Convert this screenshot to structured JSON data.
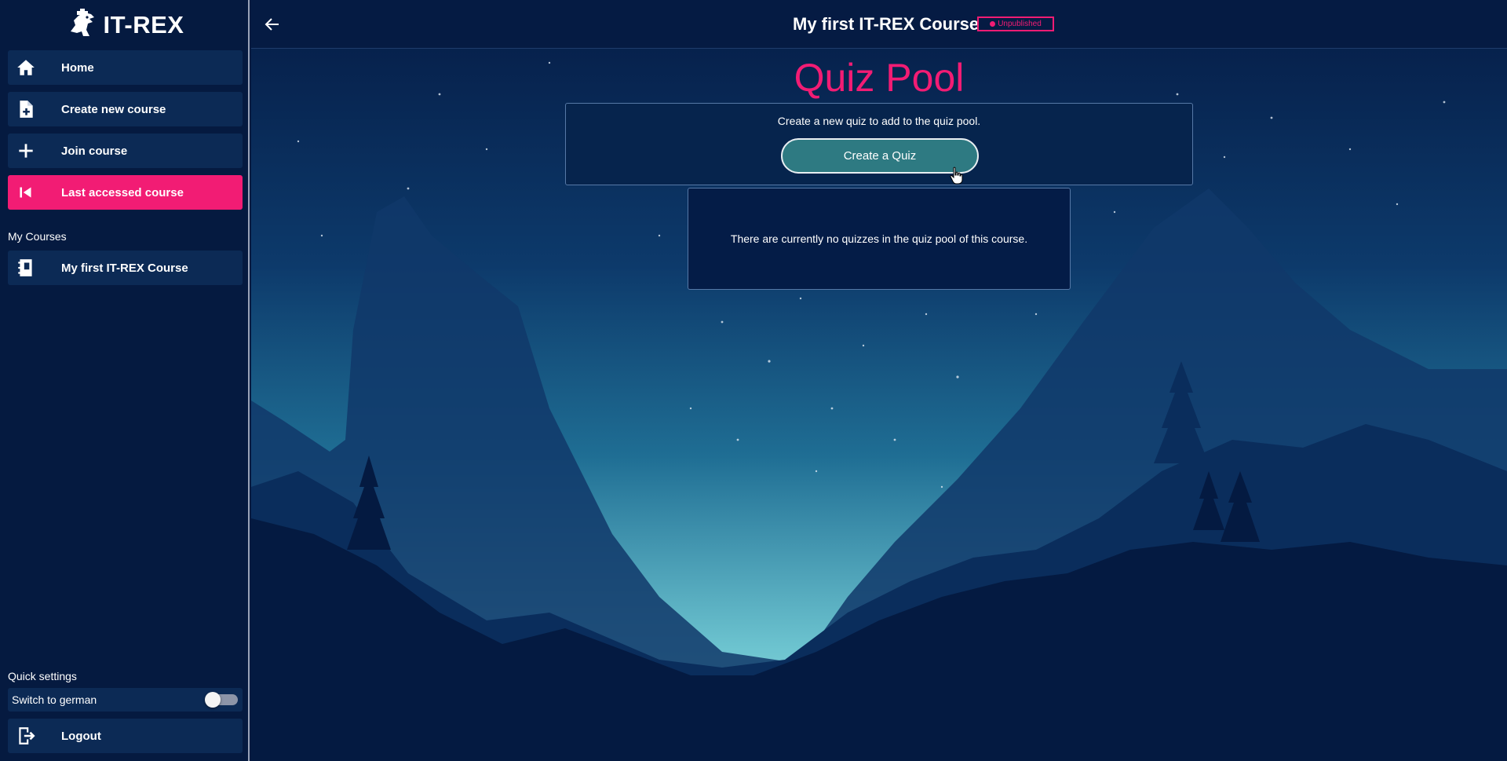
{
  "brand": {
    "name": "IT-REX",
    "logo_icon": "dinosaur-logo-icon"
  },
  "sidebar": {
    "items": [
      {
        "label": "Home",
        "icon": "home-icon"
      },
      {
        "label": "Create new course",
        "icon": "file-plus-icon"
      },
      {
        "label": "Join course",
        "icon": "plus-icon"
      },
      {
        "label": "Last accessed course",
        "icon": "skip-back-icon",
        "active": true
      }
    ],
    "my_courses_label": "My Courses",
    "courses": [
      {
        "label": "My first IT-REX Course",
        "icon": "notebook-icon"
      }
    ],
    "quick_settings_label": "Quick settings",
    "language_toggle": {
      "label": "Switch to german",
      "on": false
    },
    "logout_label": "Logout"
  },
  "header": {
    "course_title": "My first IT-REX Course",
    "status_badge": "Unpublished"
  },
  "main": {
    "page_title": "Quiz Pool",
    "create_prompt": "Create a new quiz to add to the quiz pool.",
    "create_button_label": "Create a Quiz",
    "empty_message": "There are currently no quizzes in the quiz pool of this course."
  },
  "colors": {
    "accent": "#f21c74",
    "sidebar_bg": "#051a40",
    "nav_item_bg": "#0c2a55",
    "button_teal": "#2e7a82"
  }
}
